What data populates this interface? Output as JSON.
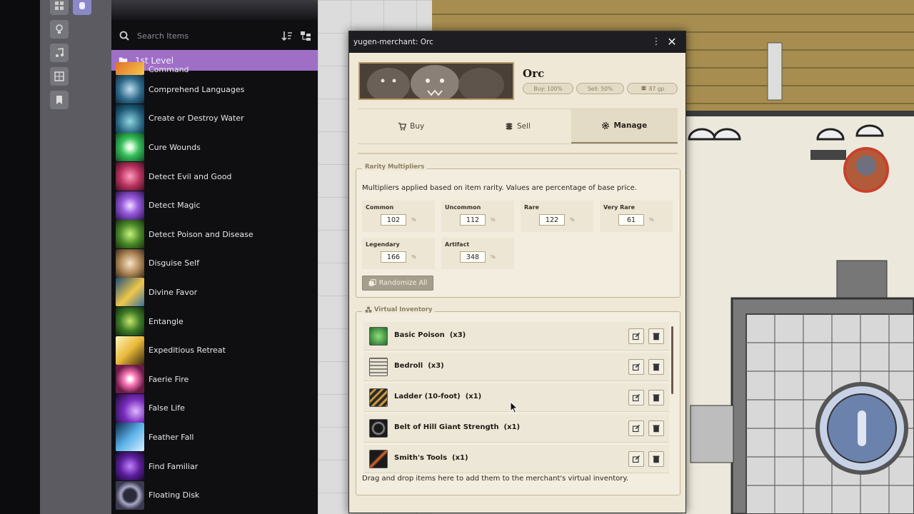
{
  "compendium": {
    "search_placeholder": "Search Items",
    "folder": "1st Level",
    "partial_item": "Command",
    "spells": [
      "Comprehend Languages",
      "Create or Destroy Water",
      "Cure Wounds",
      "Detect Evil and Good",
      "Detect Magic",
      "Detect Poison and Disease",
      "Disguise Self",
      "Divine Favor",
      "Entangle",
      "Expeditious Retreat",
      "Faerie Fire",
      "False Life",
      "Feather Fall",
      "Find Familiar",
      "Floating Disk"
    ]
  },
  "window": {
    "title": "yugen-merchant: Orc",
    "menu_glyph": "⋮",
    "close_glyph": "✕"
  },
  "merchant": {
    "name": "Orc",
    "buy_badge": "Buy: 100%",
    "sell_badge": "Sell: 50%",
    "gold_badge": "87 gp"
  },
  "tabs": {
    "buy": "Buy",
    "sell": "Sell",
    "manage": "Manage"
  },
  "rarity": {
    "legend": "Rarity Multipliers",
    "description": "Multipliers applied based on item rarity. Values are percentage of base price.",
    "pct_unit": "%",
    "cells": [
      {
        "label": "Common",
        "value": "102"
      },
      {
        "label": "Uncommon",
        "value": "112"
      },
      {
        "label": "Rare",
        "value": "122"
      },
      {
        "label": "Very Rare",
        "value": "61"
      },
      {
        "label": "Legendary",
        "value": "166"
      },
      {
        "label": "Artifact",
        "value": "348"
      }
    ],
    "randomize_label": "Randomize All"
  },
  "inventory": {
    "legend": "Virtual Inventory",
    "items": [
      {
        "name": "Basic Poison",
        "qty": "(x3)"
      },
      {
        "name": "Bedroll",
        "qty": "(x3)"
      },
      {
        "name": "Ladder (10-foot)",
        "qty": "(x1)"
      },
      {
        "name": "Belt of Hill Giant Strength",
        "qty": "(x1)"
      },
      {
        "name": "Smith's Tools",
        "qty": "(x1)"
      }
    ],
    "drop_hint": "Drag and drop items here to add them to the merchant's virtual inventory."
  }
}
